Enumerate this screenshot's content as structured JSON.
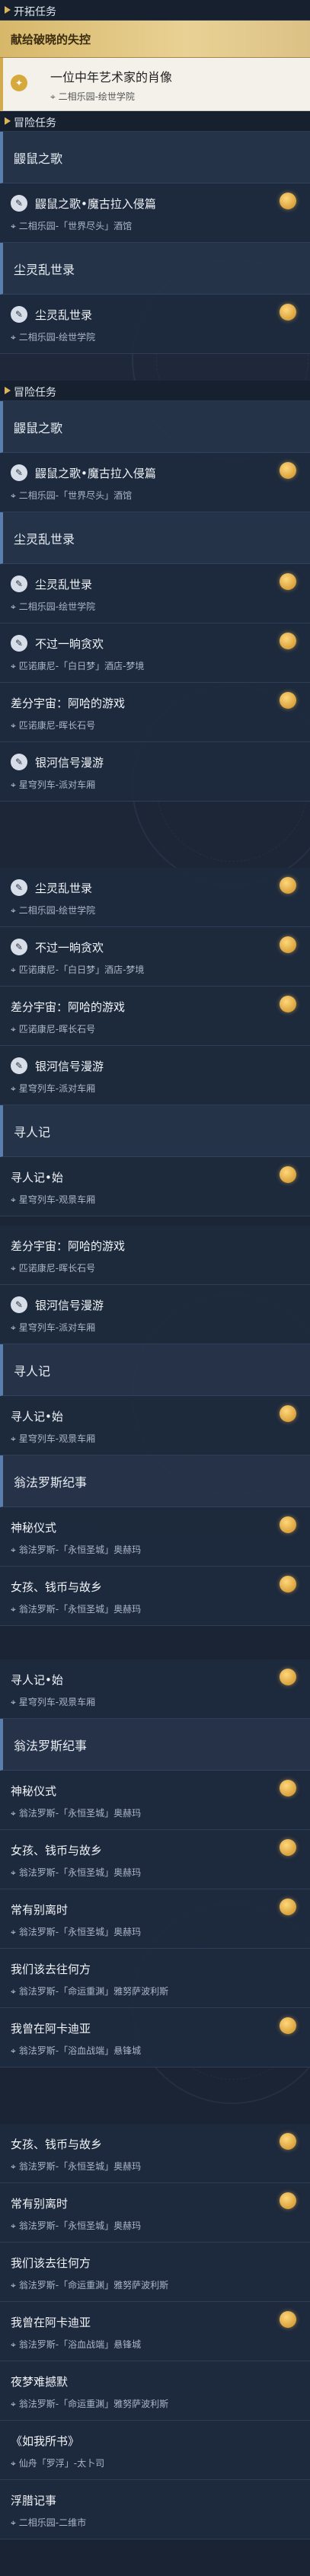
{
  "colors": {
    "gold": "#d7b86a",
    "bg": "#1b2434",
    "accent_bar": "#5a7fae"
  },
  "location_icon": "map-pin-icon",
  "quest_icon": "quest-scroll-icon",
  "reward_icon": "gold-coin-icon",
  "sections": {
    "trailblaze": "开拓任务",
    "adventure": "冒险任务",
    "adventure_dup": "冒险任务"
  },
  "trailblaze_quest": "献给破晓的失控",
  "trailblaze_active": {
    "title": "一位中年艺术家的肖像",
    "loc": "二相乐园-绘世学院"
  },
  "groups": {
    "gyy": "鼹鼠之歌",
    "cj": "尘灵乱世录",
    "xrj": "寻人记",
    "wf": "翁法罗斯纪事"
  },
  "quests": {
    "gyy": {
      "title": "鼹鼠之歌•魔古拉入侵篇",
      "loc": "二相乐园-「世界尽头」酒馆"
    },
    "cj": {
      "title": "尘灵乱世录",
      "loc": "二相乐园-绘世学院"
    },
    "bgyh": {
      "title": "不过一晌贪欢",
      "loc": "匹诺康尼-「白日梦」酒店-梦境"
    },
    "cf": {
      "title": "差分宇宙：阿哈的游戏",
      "loc": "匹诺康尼-晖长石号"
    },
    "yh": {
      "title": "银河信号漫游",
      "loc": "星穹列车-派对车厢"
    },
    "xrj": {
      "title": "寻人记•始",
      "loc": "星穹列车-观景车厢"
    },
    "smys": {
      "title": "神秘仪式",
      "loc": "翁法罗斯-「永恒圣城」奥赫玛"
    },
    "nh": {
      "title": "女孩、钱币与故乡",
      "loc": "翁法罗斯-「永恒圣城」奥赫玛"
    },
    "cyb": {
      "title": "常有别离时",
      "loc": "翁法罗斯-「永恒圣城」奥赫玛"
    },
    "wmy": {
      "title": "我们该去往何方",
      "loc": "翁法罗斯-「命运重渊」雅努萨波利斯"
    },
    "wcz": {
      "title": "我曾在阿卡迪亚",
      "loc": "翁法罗斯-「浴血战端」悬锋城"
    },
    "ymn": {
      "title": "夜梦难撼默",
      "loc": "翁法罗斯-「命运重渊」雅努萨波利斯"
    },
    "zwsh": {
      "title": "《如我所书》",
      "loc": "仙舟「罗浮」-太卜司"
    },
    "flj": {
      "title": "浮腊记事",
      "loc": "二相乐园-二维市"
    }
  },
  "fragments": {
    "xrj_overlap": "翁法罗斯纪事",
    "cf_overlap": "差分宇宙：阿哈的游戏"
  }
}
